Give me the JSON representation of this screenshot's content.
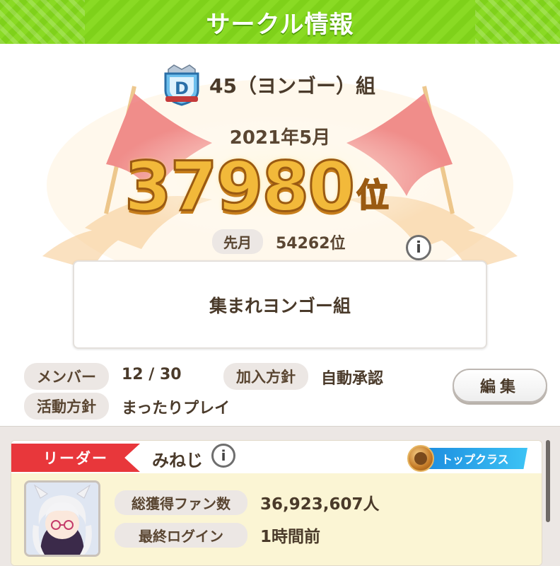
{
  "title": "サークル情報",
  "circle": {
    "rank_badge_letter": "D",
    "name": "45（ヨンゴー）組"
  },
  "ranking": {
    "month": "2021年5月",
    "rank_number": "37980",
    "rank_unit": "位",
    "info_label": "i",
    "previous_label": "先月",
    "previous_value": "54262位"
  },
  "motto": "集まれヨンゴー組",
  "meta": {
    "members_label": "メンバー",
    "members_value": "12 / 30",
    "join_policy_label": "加入方針",
    "join_policy_value": "自動承認",
    "activity_label": "活動方針",
    "activity_value": "まったりプレイ",
    "edit_label": "編集"
  },
  "leader": {
    "ribbon_label": "リーダー",
    "name": "みねじ",
    "info_label": "i",
    "class_label": "トップクラス",
    "fans_label": "総獲得ファン数",
    "fans_value": "36,923,607人",
    "login_label": "最終ログイン",
    "login_value": "1時間前"
  },
  "colors": {
    "title_green": "#7fd11a",
    "gold": "#f2b93a",
    "ribbon_red": "#e8373b",
    "class_blue": "#1e8fe0",
    "card_cream": "#fbf5d4"
  }
}
